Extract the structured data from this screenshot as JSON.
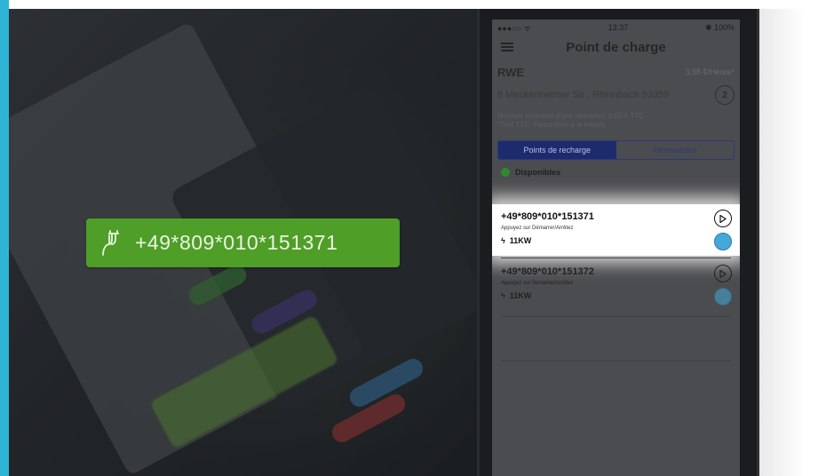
{
  "overlay": {
    "phone_number": "+49*809*010*151371",
    "icon": "ev-plug-icon",
    "pill_color": "#4e9e28"
  },
  "status_bar": {
    "carrier": "●●●○○ ᯤ",
    "time": "13:37",
    "battery": "✱ 100%"
  },
  "nav": {
    "title": "Point de charge",
    "menu_icon": "hamburger-icon"
  },
  "station": {
    "operator": "RWE",
    "price": "3,98 €/Heure*",
    "address": "8 Meckenheimer Str., Rheinbach 53359",
    "count_badge": "2",
    "min_amount": "Montant minimum d'une opération: 0,50 € TTC",
    "tariff_note": "*Tarif TTC. Facturation à la minute."
  },
  "tabs": [
    {
      "label": "Points de recharge",
      "active": true
    },
    {
      "label": "Informations",
      "active": false
    }
  ],
  "availability": {
    "label": "Disponibles",
    "color": "#2f8a2c"
  },
  "charge_points": [
    {
      "number": "+49*809*010*151371",
      "hint": "Appuyez sur Démarrer/Arrêtez",
      "power": "11KW"
    },
    {
      "number": "+49*809*010*151372",
      "hint": "Appuyez sur Démarrer/Arrêtez",
      "power": "11KW"
    }
  ],
  "colors": {
    "accent_bar": "#2fb4d6",
    "tab_active": "#1d2a6e",
    "connector": "#44a9d8"
  }
}
